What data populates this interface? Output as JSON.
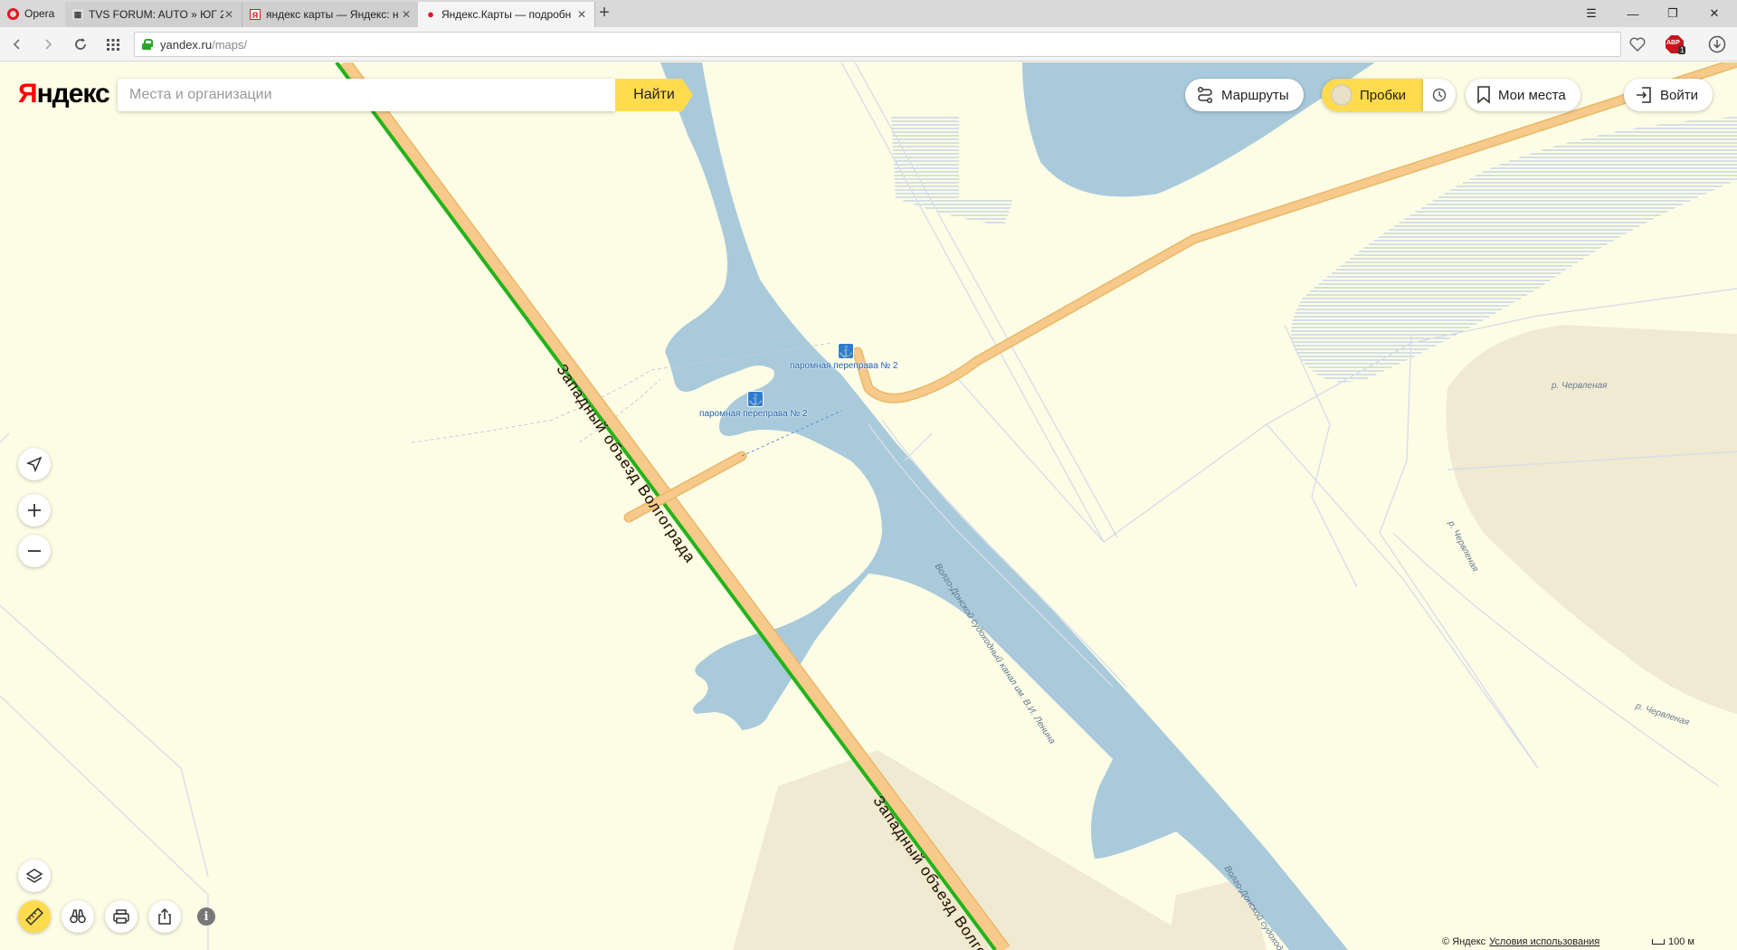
{
  "browser": {
    "menu_label": "Opera",
    "tabs": [
      {
        "title": "TVS FORUM: AUTO » ЮГ 2",
        "favicon": "forum-favicon",
        "active": false
      },
      {
        "title": "яндекс карты — Яндекс: н",
        "favicon": "yandex-favicon",
        "active": false
      },
      {
        "title": "Яндекс.Карты — подробн",
        "favicon": "map-pin-favicon",
        "active": true
      }
    ],
    "url_host": "yandex.ru",
    "url_path": "/maps/",
    "adblock_badge": "ABP",
    "adblock_count": "1"
  },
  "header": {
    "logo_first": "Я",
    "logo_rest": "ндекс",
    "search_placeholder": "Места и организации",
    "search_button": "Найти",
    "routes_label": "Маршруты",
    "traffic_label": "Пробки",
    "my_places_label": "Мои места",
    "login_label": "Войти"
  },
  "map": {
    "road_name": "Западный объезд Волгограда",
    "road_name_lower": "Западный объезд Волгог",
    "canal_name": "Волго-Донской судоходный канал им. В.И. Ленина",
    "canal_name_lower": "Волго-Донской судоходн",
    "ferry_label": "паромная переправа № 2",
    "river_label": "р. Червленая",
    "colors": {
      "land": "#fdfde6",
      "water": "#a9cadb",
      "road": "#f7c98a",
      "traffic_green": "#23b31a",
      "sand": "#f1ead2"
    }
  },
  "footer": {
    "copyright": "© Яндекс",
    "terms_link": "Условия использования",
    "scale_label": "100 м"
  }
}
